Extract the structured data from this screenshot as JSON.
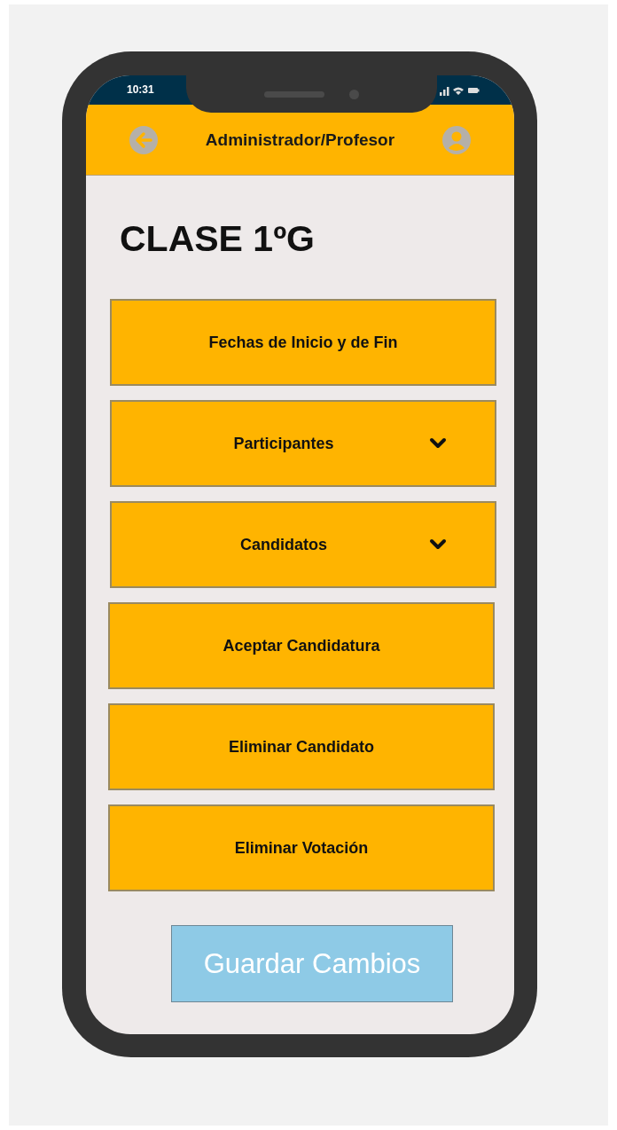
{
  "status_bar": {
    "time": "10:31"
  },
  "header": {
    "title": "Administrador/Profesor"
  },
  "page_title": "CLASE 1ºG",
  "menu_items": [
    {
      "label": "Fechas de Inicio y de Fin",
      "kind": "button"
    },
    {
      "label": "Participantes",
      "kind": "dropdown"
    },
    {
      "label": "Candidatos",
      "kind": "dropdown"
    },
    {
      "label": "Aceptar Candidatura",
      "kind": "button"
    },
    {
      "label": "Eliminar Candidato",
      "kind": "button"
    },
    {
      "label": "Eliminar Votación",
      "kind": "button"
    }
  ],
  "save_button": {
    "label": "Guardar Cambios"
  }
}
